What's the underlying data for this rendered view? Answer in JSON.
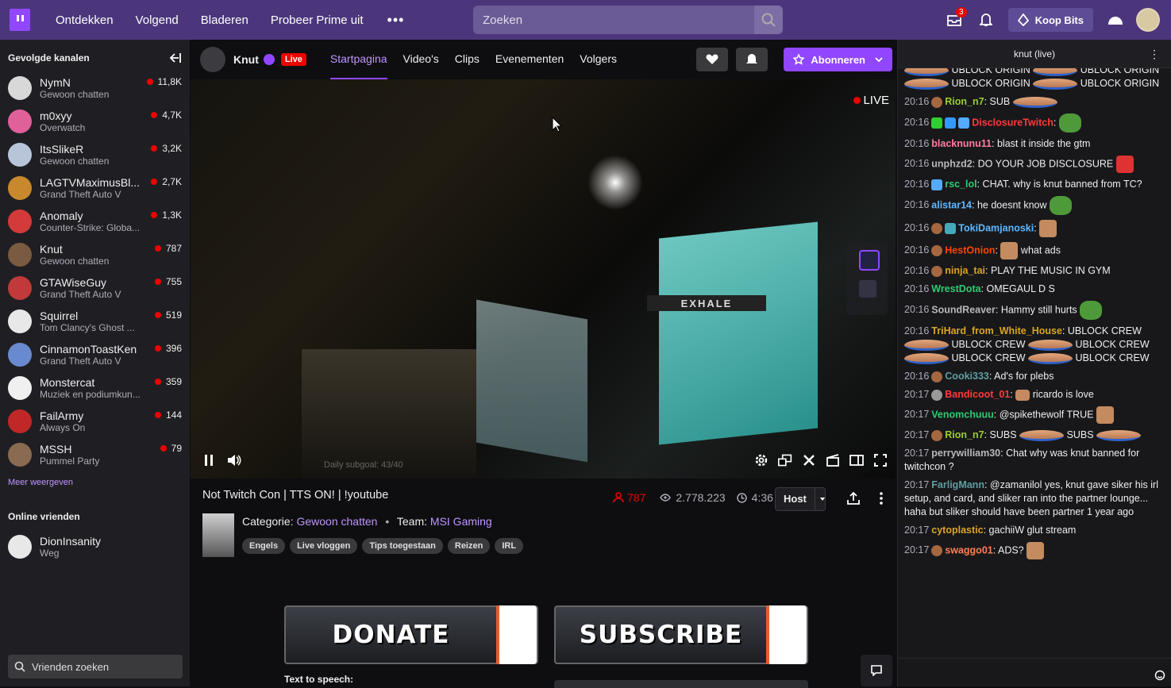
{
  "topnav": {
    "links": [
      "Ontdekken",
      "Volgend",
      "Bladeren",
      "Probeer Prime uit"
    ],
    "search_placeholder": "Zoeken",
    "inbox_count": "3",
    "bits_label": "Koop Bits"
  },
  "sidebar": {
    "heading": "Gevolgde kanalen",
    "channels": [
      {
        "name": "NymN",
        "game": "Gewoon chatten",
        "viewers": "11,8K",
        "color": "#d8d8d8"
      },
      {
        "name": "m0xyy",
        "game": "Overwatch",
        "viewers": "4,7K",
        "color": "#e0609a"
      },
      {
        "name": "ItsSlikeR",
        "game": "Gewoon chatten",
        "viewers": "3,2K",
        "color": "#b8c4d8"
      },
      {
        "name": "LAGTVMaximusBl...",
        "game": "Grand Theft Auto V",
        "viewers": "2,7K",
        "color": "#c7892c"
      },
      {
        "name": "Anomaly",
        "game": "Counter-Strike: Globa...",
        "viewers": "1,3K",
        "color": "#d33a3a"
      },
      {
        "name": "Knut",
        "game": "Gewoon chatten",
        "viewers": "787",
        "color": "#7a5a40"
      },
      {
        "name": "GTAWiseGuy",
        "game": "Grand Theft Auto V",
        "viewers": "755",
        "color": "#c03a3a"
      },
      {
        "name": "Squirrel",
        "game": "Tom Clancy's Ghost ...",
        "viewers": "519",
        "color": "#e8e8e8"
      },
      {
        "name": "CinnamonToastKen",
        "game": "Grand Theft Auto V",
        "viewers": "396",
        "color": "#6a8ad0"
      },
      {
        "name": "Monstercat",
        "game": "Muziek en podiumkun...",
        "viewers": "359",
        "color": "#f0f0f0"
      },
      {
        "name": "FailArmy",
        "game": "Always On",
        "viewers": "144",
        "color": "#c02828"
      },
      {
        "name": "MSSH",
        "game": "Pummel Party",
        "viewers": "79",
        "color": "#8a6a50"
      }
    ],
    "more_label": "Meer weergeven",
    "friends_heading": "Online vrienden",
    "friend": {
      "name": "DionInsanity",
      "status": "Weg"
    },
    "friends_search_placeholder": "Vrienden zoeken"
  },
  "channel": {
    "name": "Knut",
    "live_label": "Live",
    "tabs": [
      "Startpagina",
      "Video's",
      "Clips",
      "Evenementen",
      "Volgers"
    ],
    "subscribe_label": "Abonneren"
  },
  "video": {
    "live_label": "LIVE",
    "sign_text": "EXHALE",
    "subgoal": "Daily subgoal: 43/40"
  },
  "info": {
    "title": "Not Twitch Con | TTS ON! | !youtube",
    "viewers": "787",
    "total_views": "2.778.223",
    "uptime": "4:36",
    "host_label": "Host",
    "category_label": "Categorie:",
    "category": "Gewoon chatten",
    "team_label": "Team:",
    "team": "MSI Gaming",
    "tags": [
      "Engels",
      "Live vloggen",
      "Tips toegestaan",
      "Reizen",
      "IRL"
    ],
    "panel_donate": "DONATE",
    "panel_subscribe": "SUBSCRIBE",
    "tts_label": "Text to speech:"
  },
  "chat": {
    "header": "knut (live)",
    "top_spam": {
      "line1": "UBLOCK ORIGIN",
      "line1b": "UBLOCK",
      "line2a": "ORIGIN",
      "line2b": "UBLOCK ORIGIN",
      "line2c": "UBLOCK ORIGIN"
    },
    "messages": [
      {
        "time": "20:16",
        "user": "Rion_n7",
        "color": "#9acd32",
        "text": "SUB"
      },
      {
        "time": "20:16",
        "user": "DisclosureTwitch",
        "color": "#ff3a3a",
        "text": ""
      },
      {
        "time": "20:16",
        "user": "blacknunu11",
        "color": "#ff7f9f",
        "text": "blast it inside the gtm"
      },
      {
        "time": "20:16",
        "user": "unphzd2",
        "color": "#b8b8b8",
        "text": "DO YOUR JOB DISCLOSURE"
      },
      {
        "time": "20:16",
        "user": "rsc_lol",
        "color": "#2ecc71",
        "text": "CHAT. why is knut banned from TC?"
      },
      {
        "time": "20:16",
        "user": "alistar14",
        "color": "#5fb8ff",
        "text": "he doesnt know"
      },
      {
        "time": "20:16",
        "user": "TokiDamjanoski",
        "color": "#5fb8ff",
        "text": ""
      },
      {
        "time": "20:16",
        "user": "HestOnion",
        "color": "#ff4500",
        "text": "what ads"
      },
      {
        "time": "20:16",
        "user": "ninja_tai",
        "color": "#daa520",
        "text": "PLAY THE MUSIC IN GYM"
      },
      {
        "time": "20:16",
        "user": "WrestDota",
        "color": "#2ecc71",
        "text": "OMEGAUL D S"
      },
      {
        "time": "20:16",
        "user": "SoundReaver",
        "color": "#b8b8b8",
        "text": "Hammy still hurts"
      },
      {
        "time": "20:16",
        "user": "TriHard_from_White_House",
        "color": "#daa520",
        "text": "UBLOCK CREW"
      },
      {
        "time": "20:16",
        "user": "Cooki333",
        "color": "#5f9ea0",
        "text": "Ad's for plebs"
      },
      {
        "time": "20:17",
        "user": "Bandicoot_01",
        "color": "#ff3a3a",
        "text": "ricardo is love"
      },
      {
        "time": "20:17",
        "user": "Venomchuuu",
        "color": "#2ecc71",
        "text": "@spikethewolf TRUE"
      },
      {
        "time": "20:17",
        "user": "Rion_n7",
        "color": "#9acd32",
        "text": "SUBS"
      },
      {
        "time": "20:17",
        "user": "perrywilliam30",
        "color": "#b8b8b8",
        "text": "Chat why was knut banned for twitchcon ?"
      },
      {
        "time": "20:17",
        "user": "FarligMann",
        "color": "#5f9ea0",
        "text": "@zamanilol yes, knut gave siker his irl setup, and card, and sliker ran into the partner lounge... haha but sliker should have been partner 1 year ago"
      },
      {
        "time": "20:17",
        "user": "cytoplastic",
        "color": "#daa520",
        "text": "gachiiW glut stream"
      },
      {
        "time": "20:17",
        "user": "swaggo01",
        "color": "#ff7f50",
        "text": "ADS?"
      }
    ],
    "crew_spam": {
      "a": "UBLOCK CREW",
      "b": "UBLOCK",
      "c": "CREW",
      "d": "UBLOCK CREW",
      "e": "UBLOCK CREW"
    },
    "subs_extra": "SUBS"
  }
}
